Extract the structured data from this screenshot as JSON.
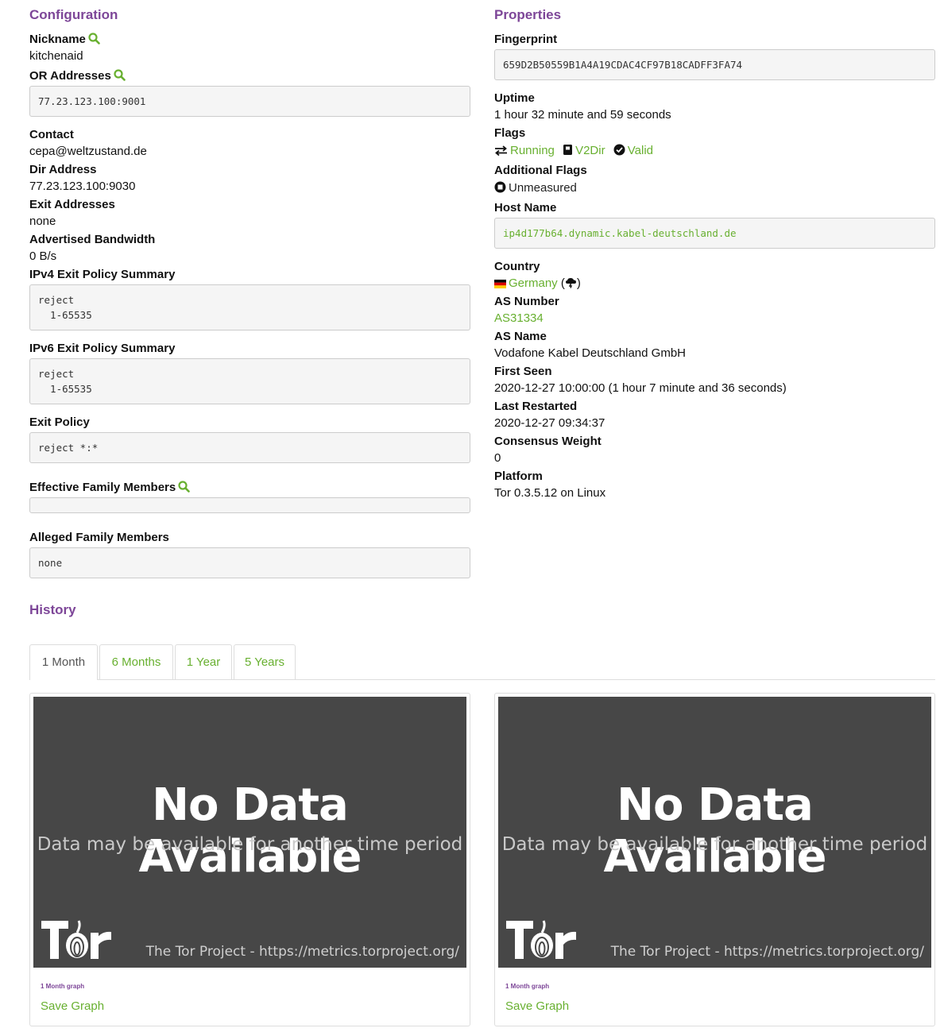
{
  "configuration": {
    "heading": "Configuration",
    "nickname_label": "Nickname",
    "nickname": "kitchenaid",
    "or_addresses_label": "OR Addresses",
    "or_addresses": "77.23.123.100:9001",
    "contact_label": "Contact",
    "contact": "cepa@weltzustand.de",
    "dir_address_label": "Dir Address",
    "dir_address": "77.23.123.100:9030",
    "exit_addresses_label": "Exit Addresses",
    "exit_addresses": "none",
    "advertised_bandwidth_label": "Advertised Bandwidth",
    "advertised_bandwidth": "0 B/s",
    "ipv4_policy_label": "IPv4 Exit Policy Summary",
    "ipv4_policy": "reject\n  1-65535",
    "ipv6_policy_label": "IPv6 Exit Policy Summary",
    "ipv6_policy": "reject\n  1-65535",
    "exit_policy_label": "Exit Policy",
    "exit_policy": "reject *:*",
    "effective_family_label": "Effective Family Members",
    "effective_family": "",
    "alleged_family_label": "Alleged Family Members",
    "alleged_family": "none"
  },
  "properties": {
    "heading": "Properties",
    "fingerprint_label": "Fingerprint",
    "fingerprint": "659D2B50559B1A4A19CDAC4CF97B18CADFF3FA74",
    "uptime_label": "Uptime",
    "uptime": "1 hour 32 minute and 59 seconds",
    "flags_label": "Flags",
    "flags": [
      {
        "icon": "arrows-exchange-icon",
        "label": "Running"
      },
      {
        "icon": "v2dir-book-icon",
        "label": "V2Dir"
      },
      {
        "icon": "check-circle-icon",
        "label": "Valid"
      }
    ],
    "additional_flags_label": "Additional Flags",
    "additional_flags": [
      {
        "icon": "stop-circle-icon",
        "label": "Unmeasured"
      }
    ],
    "host_name_label": "Host Name",
    "host_name": "ip4d177b64.dynamic.kabel-deutschland.de",
    "country_label": "Country",
    "country": "Germany",
    "country_extra_open": " (",
    "country_extra_close": ")",
    "as_number_label": "AS Number",
    "as_number": "AS31334",
    "as_name_label": "AS Name",
    "as_name": "Vodafone Kabel Deutschland GmbH",
    "first_seen_label": "First Seen",
    "first_seen": "2020-12-27 10:00:00 (1 hour 7 minute and 36 seconds)",
    "last_restarted_label": "Last Restarted",
    "last_restarted": "2020-12-27 09:34:37",
    "consensus_weight_label": "Consensus Weight",
    "consensus_weight": "0",
    "platform_label": "Platform",
    "platform": "Tor 0.3.5.12 on Linux"
  },
  "history": {
    "heading": "History",
    "tabs": [
      {
        "label": "1 Month",
        "active": true
      },
      {
        "label": "6 Months",
        "active": false
      },
      {
        "label": "1 Year",
        "active": false
      },
      {
        "label": "5 Years",
        "active": false
      }
    ],
    "graphs": [
      {
        "title": "No Data Available",
        "subtitle": "Data may be available for another time period",
        "credit": "The Tor Project - https://metrics.torproject.org/",
        "logo_text": "Tor",
        "caption": "1 Month graph",
        "save_label": "Save Graph"
      },
      {
        "title": "No Data Available",
        "subtitle": "Data may be available for another time period",
        "credit": "The Tor Project - https://metrics.torproject.org/",
        "logo_text": "Tor",
        "caption": "1 Month graph",
        "save_label": "Save Graph"
      }
    ]
  },
  "colors": {
    "heading": "#7d4698",
    "link": "#68b030",
    "graph_background": "#474747"
  }
}
